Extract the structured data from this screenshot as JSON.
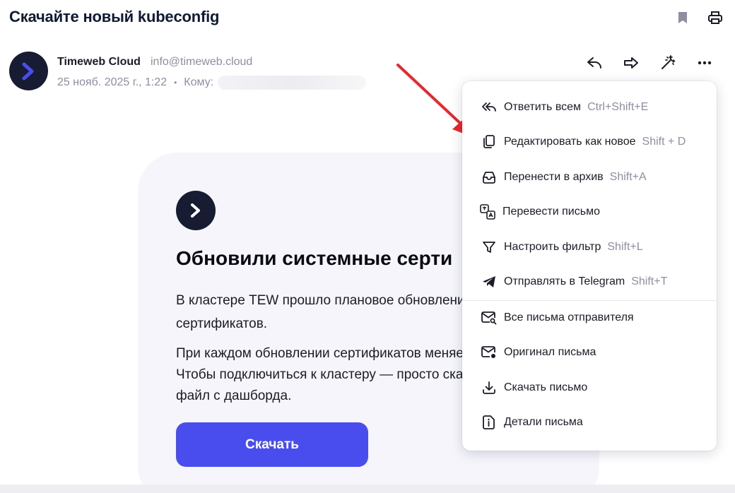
{
  "subject": "Скачайте новый kubeconfig",
  "sender": {
    "name": "Timeweb Cloud",
    "email": "info@timeweb.cloud",
    "date": "25 нояб. 2025 г., 1:22",
    "dot": "•",
    "to_label": "Кому:"
  },
  "toolbar": {
    "icons": [
      "bookmark-icon",
      "print-icon",
      "reply-icon",
      "forward-icon",
      "magic-wand-icon",
      "more-icon"
    ]
  },
  "card": {
    "title": "Обновили системные серти",
    "para1_line1": "В кластере TEW прошло плановое обновлени",
    "para1_line2": "сертификатов.",
    "para2_line1": "При каждом обновлении сертификатов меняе",
    "para2_line2": "Чтобы подключиться к кластеру — просто ска",
    "para2_line3": "файл с дашборда.",
    "button": "Скачать"
  },
  "menu": {
    "items": [
      {
        "label": "Ответить всем",
        "shortcut": "Ctrl+Shift+E",
        "icon": "reply-all-icon"
      },
      {
        "label": "Редактировать как новое",
        "shortcut": "Shift + D",
        "icon": "copy-icon"
      },
      {
        "label": "Перенести в архив",
        "shortcut": "Shift+A",
        "icon": "archive-icon"
      },
      {
        "label": "Перевести письмо",
        "shortcut": "",
        "icon": "translate-icon"
      },
      {
        "label": "Настроить фильтр",
        "shortcut": "Shift+L",
        "icon": "filter-icon"
      },
      {
        "label": "Отправлять в Telegram",
        "shortcut": "Shift+T",
        "icon": "telegram-icon"
      },
      {
        "label": "Все письма отправителя",
        "shortcut": "",
        "icon": "mail-search-icon"
      },
      {
        "label": "Оригинал письма",
        "shortcut": "",
        "icon": "mail-original-icon"
      },
      {
        "label": "Скачать письмо",
        "shortcut": "",
        "icon": "download-icon"
      },
      {
        "label": "Детали письма",
        "shortcut": "",
        "icon": "details-icon"
      }
    ]
  },
  "colors": {
    "accent": "#4a4ded",
    "avatar_bg": "#171c33",
    "card_bg": "#f5f5fb",
    "arrow": "#e8272c",
    "muted_text": "#8d8fa0"
  }
}
